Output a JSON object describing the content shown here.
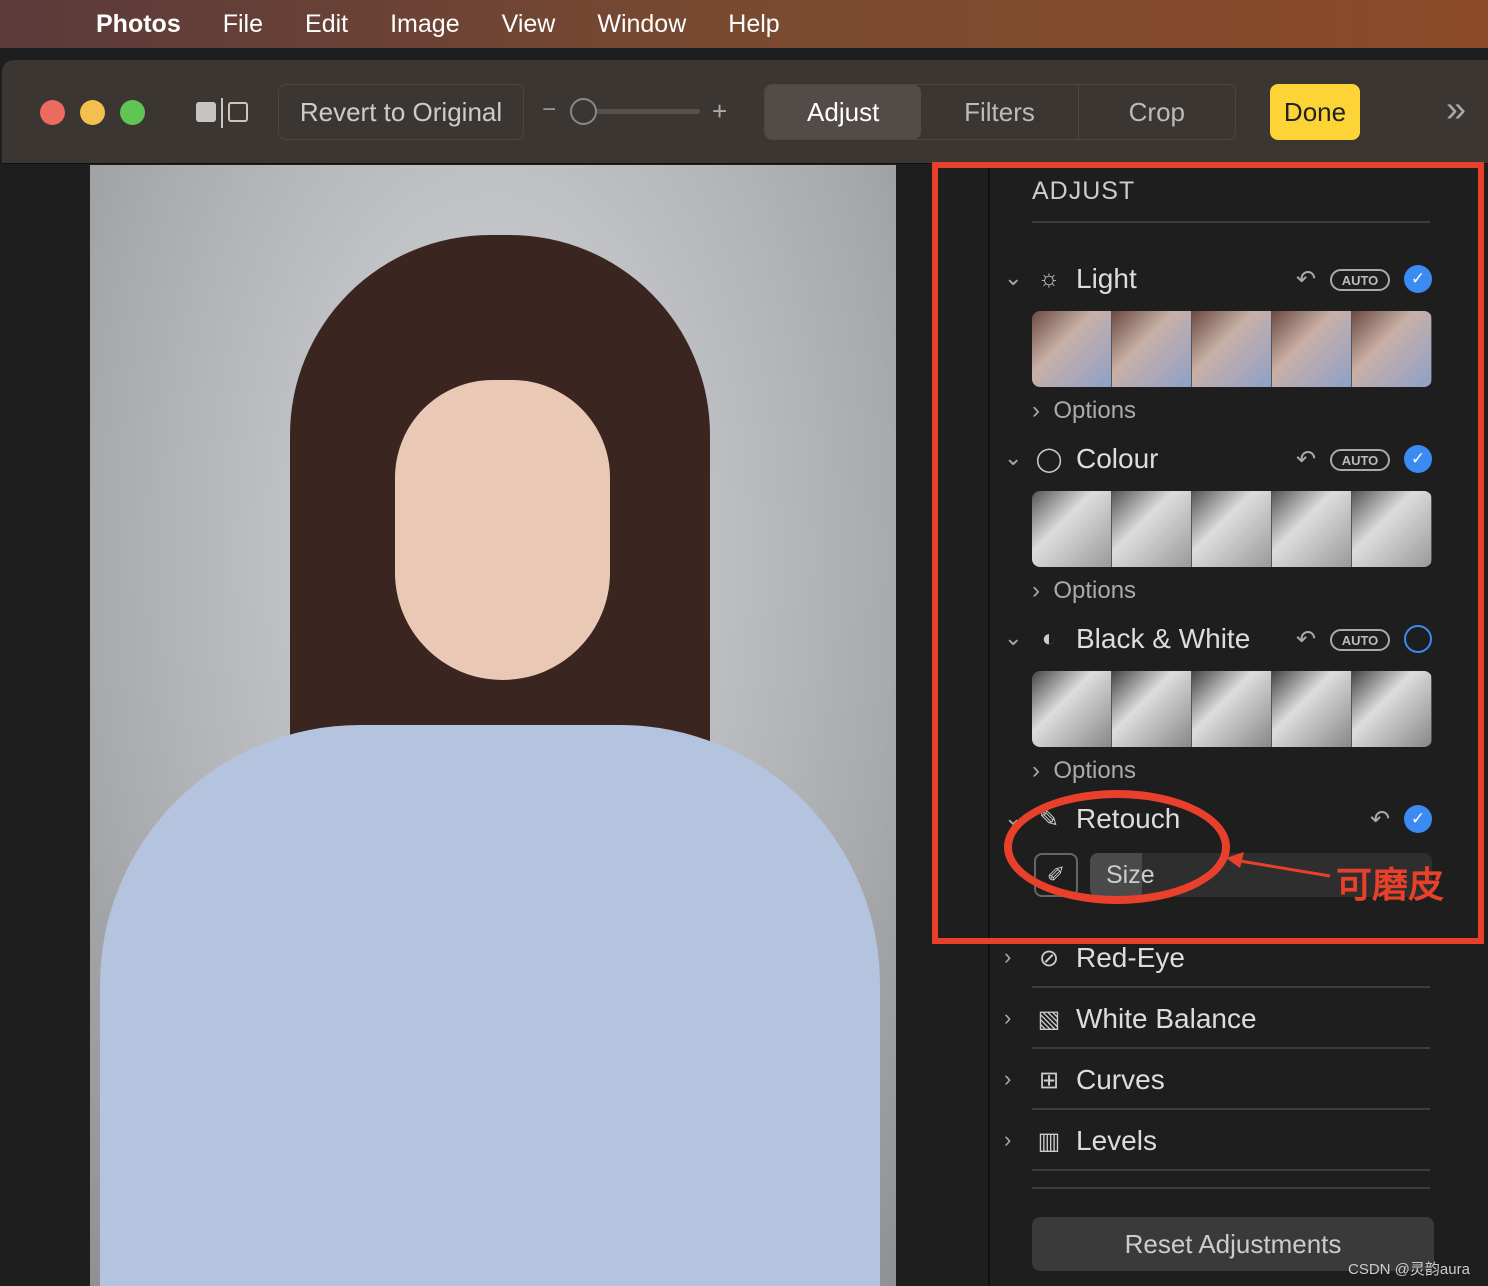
{
  "menubar": {
    "apple": "apple-icon",
    "items": [
      "Photos",
      "File",
      "Edit",
      "Image",
      "View",
      "Window",
      "Help"
    ]
  },
  "toolbar": {
    "revert": "Revert to Original",
    "minus": "−",
    "plus": "+",
    "tabs": [
      "Adjust",
      "Filters",
      "Crop"
    ],
    "active_tab": "Adjust",
    "done": "Done",
    "more": "»"
  },
  "panel": {
    "title": "ADJUST",
    "sections": [
      {
        "label": "Light",
        "icon": "sun-icon",
        "auto": "AUTO",
        "checked": true,
        "options": "Options"
      },
      {
        "label": "Colour",
        "icon": "color-wheel-icon",
        "auto": "AUTO",
        "checked": true,
        "options": "Options"
      },
      {
        "label": "Black & White",
        "icon": "half-circle-icon",
        "auto": "AUTO",
        "checked": false,
        "options": "Options"
      }
    ],
    "retouch": {
      "label": "Retouch",
      "size_label": "Size",
      "checked": true
    },
    "collapsed": [
      {
        "label": "Red-Eye",
        "icon": "eye-slash-icon"
      },
      {
        "label": "White Balance",
        "icon": "white-balance-icon"
      },
      {
        "label": "Curves",
        "icon": "curves-icon"
      },
      {
        "label": "Levels",
        "icon": "levels-icon"
      }
    ],
    "reset": "Reset Adjustments"
  },
  "annotation": {
    "text": "可磨皮",
    "color": "#e8402a"
  },
  "watermark": "CSDN @灵韵aura",
  "colors": {
    "accent": "#3b8bf3",
    "done": "#fdd435"
  }
}
